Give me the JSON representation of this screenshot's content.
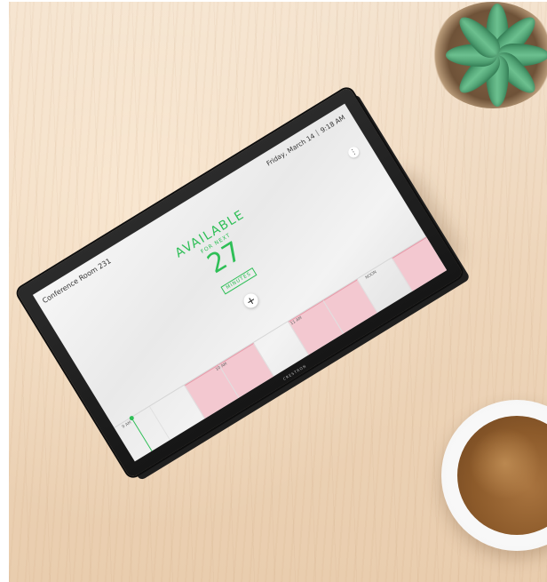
{
  "room_name": "Conference Room 231",
  "date": "Friday, March 14",
  "time": "9:18 AM",
  "status": {
    "state": "AVAILABLE",
    "subtitle": "FOR NEXT",
    "minutes": "27",
    "unit": "MINUTES"
  },
  "buttons": {
    "more_label": "⋮",
    "add_label": "+"
  },
  "device_brand": "CRESTRON",
  "timeline": {
    "ticks": [
      "9 AM",
      "10 AM",
      "11 AM",
      "NOON"
    ],
    "segments": [
      {
        "busy": false
      },
      {
        "busy": false
      },
      {
        "busy": true
      },
      {
        "busy": true
      },
      {
        "busy": false
      },
      {
        "busy": true
      },
      {
        "busy": true
      },
      {
        "busy": false
      },
      {
        "busy": true
      }
    ]
  },
  "colors": {
    "available": "#2fbf57",
    "busy": "#f3c8d0"
  }
}
